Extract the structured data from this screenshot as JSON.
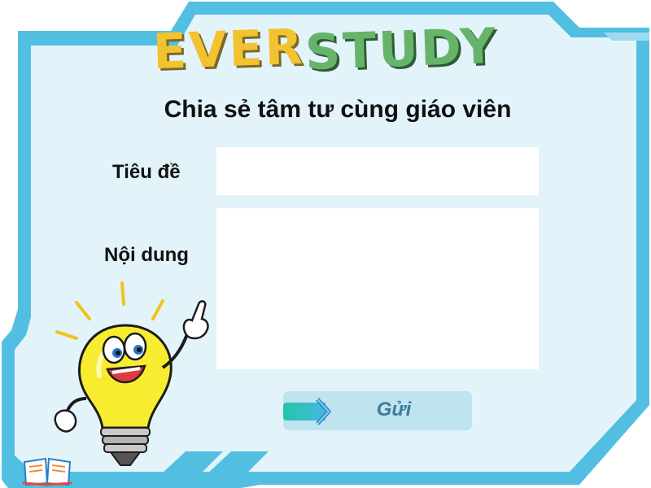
{
  "logo": {
    "part1": "EVER",
    "part2": "STUDY"
  },
  "heading": "Chia sẻ tâm tư cùng giáo viên",
  "form": {
    "title_label": "Tiêu đề",
    "title_value": "",
    "content_label": "Nội dung",
    "content_value": "",
    "submit_label": "Gửi"
  },
  "colors": {
    "frame": "#52bfe2",
    "panel": "#e2f4fa",
    "logo_ever": "#f2c230",
    "logo_study": "#66b46b",
    "button_bg": "#bfe3ef",
    "button_text": "#3d7d99"
  },
  "icons": [
    "lightbulb-mascot-icon",
    "open-book-icon",
    "chevron-right-icon"
  ]
}
